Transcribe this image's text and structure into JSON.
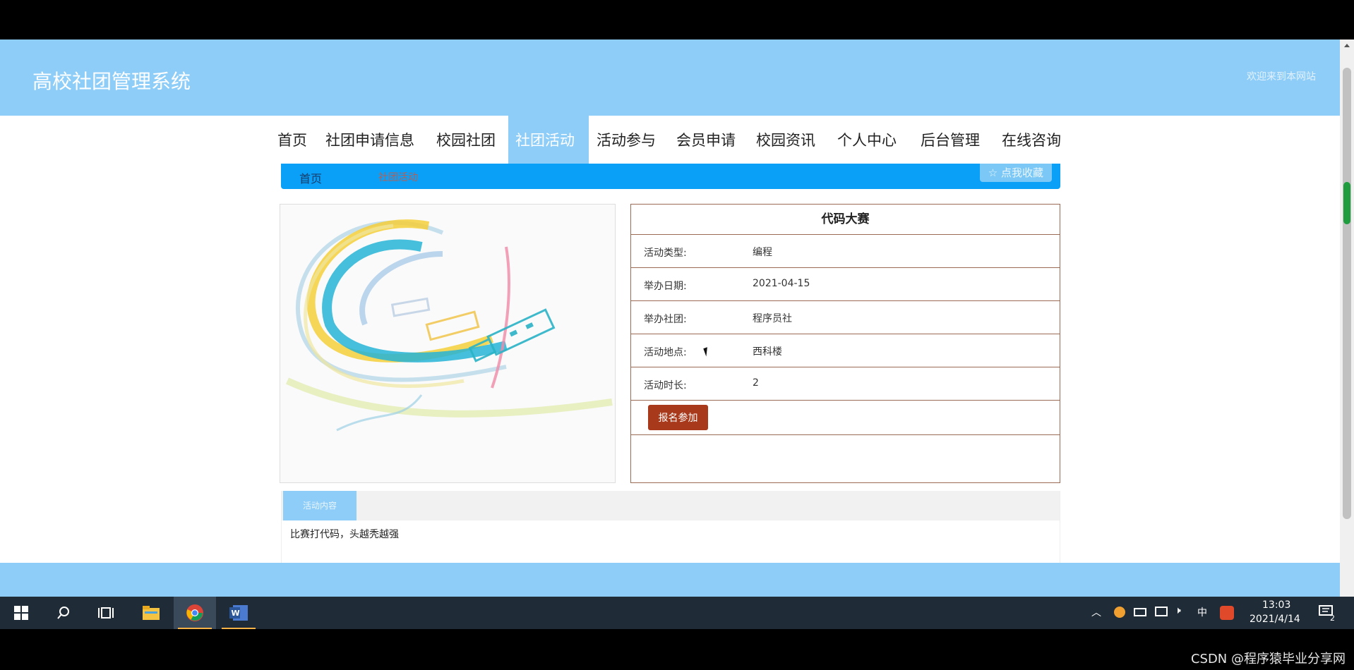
{
  "site": {
    "title": "高校社团管理系统",
    "welcome": "欢迎来到本网站"
  },
  "nav": {
    "items": [
      {
        "label": "首页"
      },
      {
        "label": "社团申请信息"
      },
      {
        "label": "校园社团"
      },
      {
        "label": "社团活动"
      },
      {
        "label": "活动参与"
      },
      {
        "label": "会员申请"
      },
      {
        "label": "校园资讯"
      },
      {
        "label": "个人中心"
      },
      {
        "label": "后台管理"
      },
      {
        "label": "在线咨询"
      }
    ],
    "active": "社团活动"
  },
  "breadcrumb": {
    "home": "首页",
    "current": "社团活动",
    "favorite_label": "☆ 点我收藏"
  },
  "activity": {
    "title": "代码大赛",
    "rows": [
      {
        "label": "活动类型:",
        "value": "编程"
      },
      {
        "label": "举办日期:",
        "value": "2021-04-15"
      },
      {
        "label": "举办社团:",
        "value": "程序员社"
      },
      {
        "label": "活动地点:",
        "value": "西科楼"
      },
      {
        "label": "活动时长:",
        "value": "2"
      }
    ],
    "join_label": "报名参加"
  },
  "content": {
    "tab_label": "活动内容",
    "text": "比赛打代码，头越秃越强"
  },
  "taskbar": {
    "time": "13:03",
    "date": "2021/4/14",
    "ime": "中",
    "notifications": "2"
  },
  "watermark": "CSDN @程序猿毕业分享网"
}
